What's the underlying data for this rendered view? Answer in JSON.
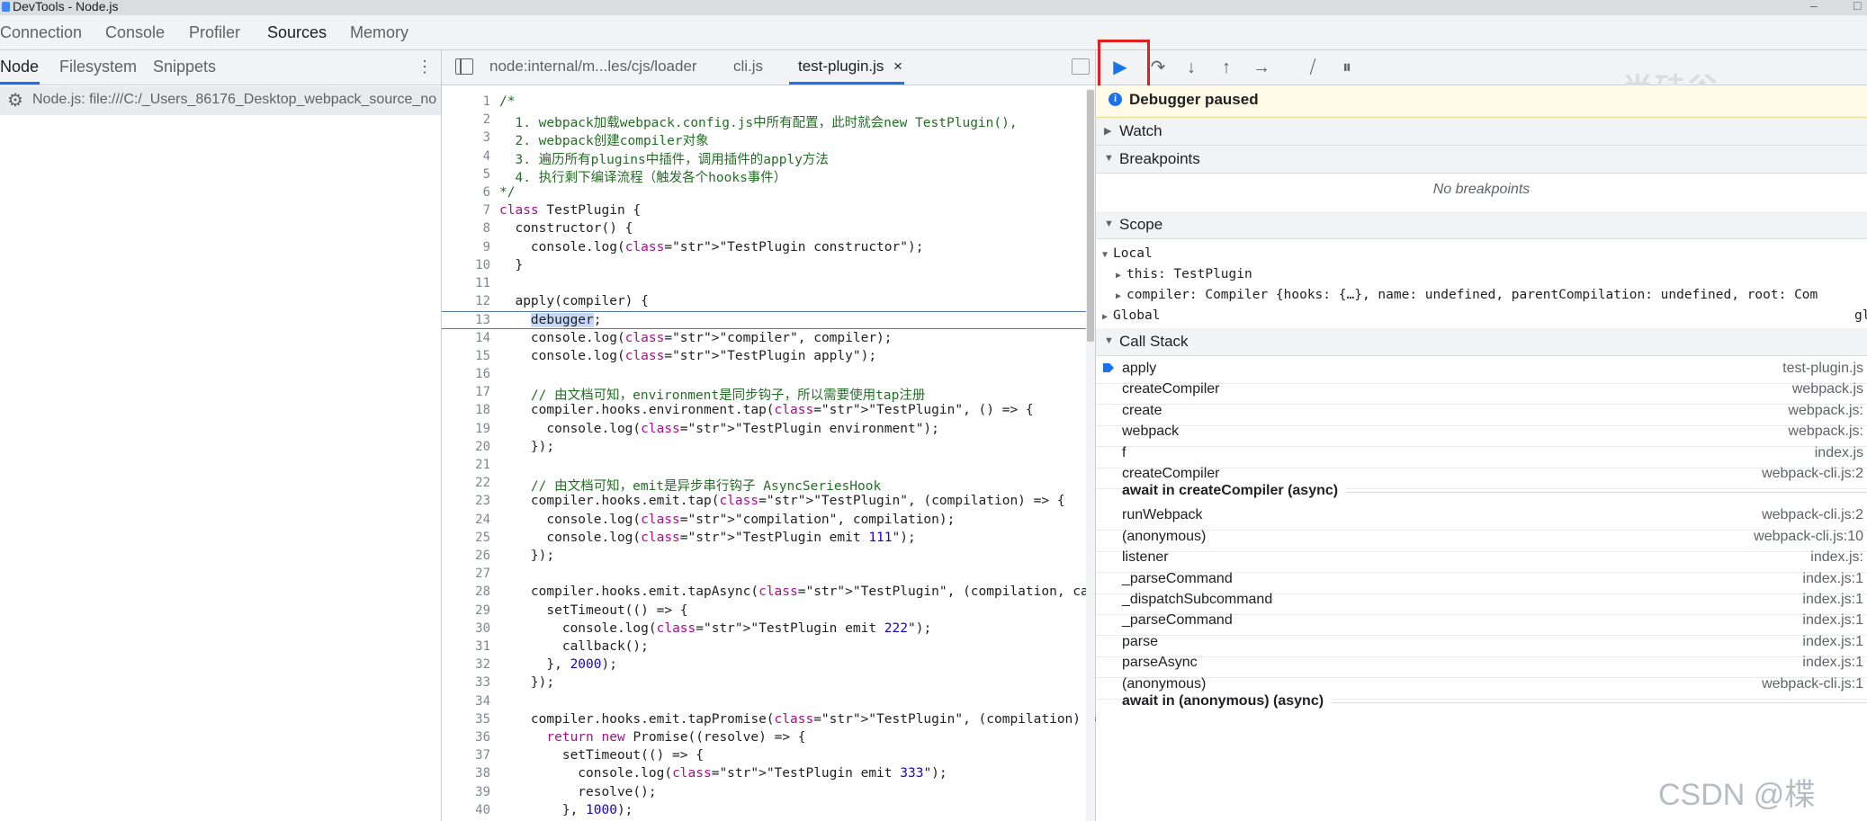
{
  "window": {
    "title": "DevTools - Node.js"
  },
  "main_tabs": [
    "Connection",
    "Console",
    "Profiler",
    "Sources",
    "Memory"
  ],
  "navigator": {
    "tabs": [
      "Node",
      "Filesystem",
      "Snippets"
    ],
    "item": "Node.js: file:///C:/_Users_86176_Desktop_webpack_source_no"
  },
  "editor": {
    "tabs": [
      "node:internal/m...les/cjs/loader",
      "cli.js",
      "test-plugin.js"
    ],
    "active_close": "×",
    "lines": [
      {
        "n": "1",
        "t": "/*"
      },
      {
        "n": "2",
        "t": "  1. webpack加载webpack.config.js中所有配置，此时就会new TestPlugin(),"
      },
      {
        "n": "3",
        "t": "  2. webpack创建compiler对象"
      },
      {
        "n": "4",
        "t": "  3. 遍历所有plugins中插件，调用插件的apply方法"
      },
      {
        "n": "5",
        "t": "  4. 执行剩下编译流程（触发各个hooks事件）"
      },
      {
        "n": "6",
        "t": "*/"
      },
      {
        "n": "7",
        "t": "class TestPlugin {"
      },
      {
        "n": "8",
        "t": "  constructor() {"
      },
      {
        "n": "9",
        "t": "    console.log(\"TestPlugin constructor\");"
      },
      {
        "n": "10",
        "t": "  }"
      },
      {
        "n": "11",
        "t": ""
      },
      {
        "n": "12",
        "t": "  apply(compiler) {"
      },
      {
        "n": "13",
        "t": "    debugger;"
      },
      {
        "n": "14",
        "t": "    console.log(\"compiler\", compiler);"
      },
      {
        "n": "15",
        "t": "    console.log(\"TestPlugin apply\");"
      },
      {
        "n": "16",
        "t": ""
      },
      {
        "n": "17",
        "t": "    // 由文档可知，environment是同步钩子，所以需要使用tap注册"
      },
      {
        "n": "18",
        "t": "    compiler.hooks.environment.tap(\"TestPlugin\", () => {"
      },
      {
        "n": "19",
        "t": "      console.log(\"TestPlugin environment\");"
      },
      {
        "n": "20",
        "t": "    });"
      },
      {
        "n": "21",
        "t": ""
      },
      {
        "n": "22",
        "t": "    // 由文档可知，emit是异步串行钩子 AsyncSeriesHook"
      },
      {
        "n": "23",
        "t": "    compiler.hooks.emit.tap(\"TestPlugin\", (compilation) => {"
      },
      {
        "n": "24",
        "t": "      console.log(\"compilation\", compilation);"
      },
      {
        "n": "25",
        "t": "      console.log(\"TestPlugin emit 111\");"
      },
      {
        "n": "26",
        "t": "    });"
      },
      {
        "n": "27",
        "t": ""
      },
      {
        "n": "28",
        "t": "    compiler.hooks.emit.tapAsync(\"TestPlugin\", (compilation, callback)"
      },
      {
        "n": "29",
        "t": "      setTimeout(() => {"
      },
      {
        "n": "30",
        "t": "        console.log(\"TestPlugin emit 222\");"
      },
      {
        "n": "31",
        "t": "        callback();"
      },
      {
        "n": "32",
        "t": "      }, 2000);"
      },
      {
        "n": "33",
        "t": "    });"
      },
      {
        "n": "34",
        "t": ""
      },
      {
        "n": "35",
        "t": "    compiler.hooks.emit.tapPromise(\"TestPlugin\", (compilation) => {"
      },
      {
        "n": "36",
        "t": "      return new Promise((resolve) => {"
      },
      {
        "n": "37",
        "t": "        setTimeout(() => {"
      },
      {
        "n": "38",
        "t": "          console.log(\"TestPlugin emit 333\");"
      },
      {
        "n": "39",
        "t": "          resolve();"
      },
      {
        "n": "40",
        "t": "        }, 1000);"
      }
    ]
  },
  "debugger": {
    "paused_text": "Debugger paused",
    "sections": {
      "watch": "Watch",
      "breakpoints": "Breakpoints",
      "scope": "Scope",
      "callstack": "Call Stack"
    },
    "no_breakpoints": "No breakpoints",
    "scope": {
      "local": "Local",
      "this_line": "this: TestPlugin",
      "compiler_line": "compiler: Compiler {hooks: {…}, name: undefined, parentCompilation: undefined, root: Com",
      "global": "Global",
      "global_value": "gl"
    },
    "call_stack": [
      {
        "fn": "apply",
        "loc": "test-plugin.js"
      },
      {
        "fn": "createCompiler",
        "loc": "webpack.js"
      },
      {
        "fn": "create",
        "loc": "webpack.js:"
      },
      {
        "fn": "webpack",
        "loc": "webpack.js:"
      },
      {
        "fn": "f",
        "loc": "index.js"
      },
      {
        "fn": "createCompiler",
        "loc": "webpack-cli.js:2"
      },
      {
        "async": "await in createCompiler (async)"
      },
      {
        "fn": "runWebpack",
        "loc": "webpack-cli.js:2"
      },
      {
        "fn": "(anonymous)",
        "loc": "webpack-cli.js:10"
      },
      {
        "fn": "listener",
        "loc": "index.js:"
      },
      {
        "fn": "_parseCommand",
        "loc": "index.js:1"
      },
      {
        "fn": "_dispatchSubcommand",
        "loc": "index.js:1"
      },
      {
        "fn": "_parseCommand",
        "loc": "index.js:1"
      },
      {
        "fn": "parse",
        "loc": "index.js:1"
      },
      {
        "fn": "parseAsync",
        "loc": "index.js:1"
      },
      {
        "fn": "(anonymous)",
        "loc": "webpack-cli.js:1"
      },
      {
        "async": "await in (anonymous) (async)"
      }
    ]
  },
  "watermarks": {
    "top": "尚硅谷",
    "bottom": "CSDN @楪"
  },
  "colors": {
    "accent": "#1a73e8",
    "highlight_box": "#e0201c",
    "paused_bg": "#fffbe6"
  }
}
